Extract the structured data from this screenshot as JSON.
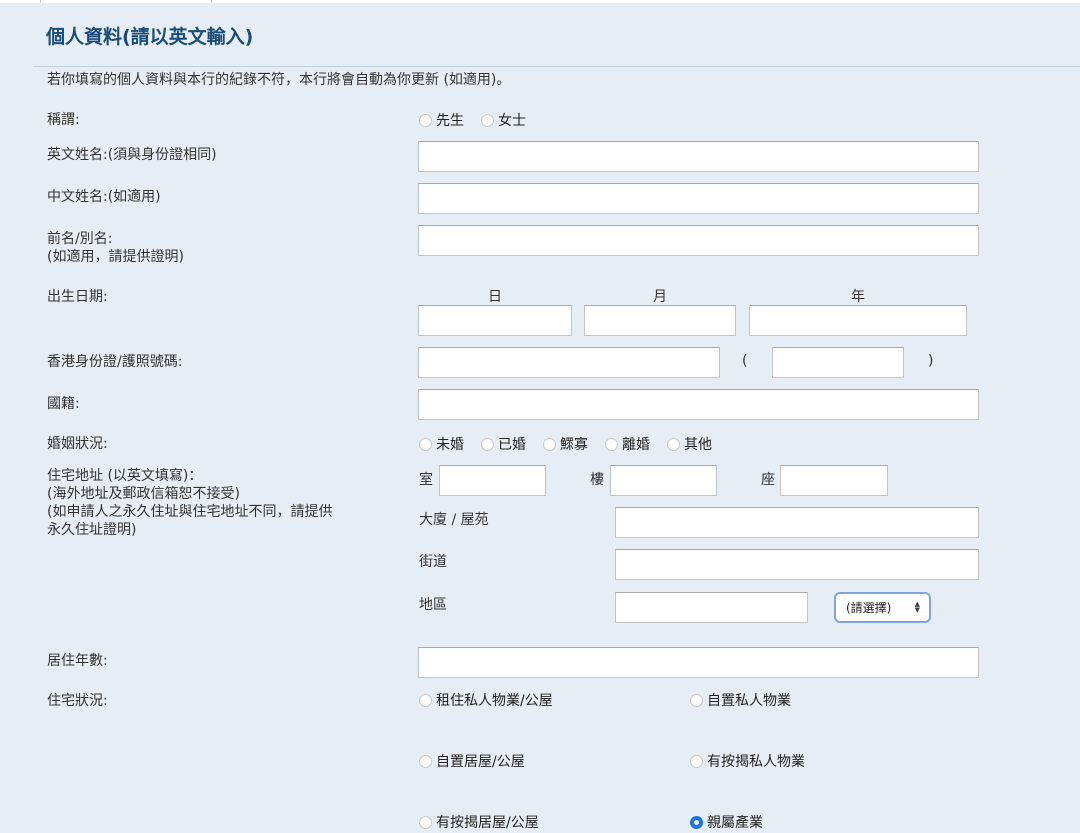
{
  "section": {
    "title": "個人資料(請以英文輸入)",
    "notice": "若你填寫的個人資料與本行的紀錄不符，本行將會自動為你更新 (如適用)。"
  },
  "fields": {
    "title_label": "稱謂:",
    "title_options": [
      "先生",
      "女士"
    ],
    "english_name_label": "英文姓名:(須與身份證相同)",
    "chinese_name_label": "中文姓名:(如適用)",
    "alias_label": "前名/別名:\n(如適用，請提供證明)",
    "dob_label": "出生日期:",
    "dob_day": "日",
    "dob_month": "月",
    "dob_year": "年",
    "id_label": "香港身份證/護照號碼:",
    "id_open": "(",
    "id_close": ")",
    "nationality_label": "國籍:",
    "marital_label": "婚姻狀況:",
    "marital_options": [
      "未婚",
      "已婚",
      "鰥寡",
      "離婚",
      "其他"
    ],
    "address_label": "住宅地址 (以英文填寫)：\n(海外地址及郵政信箱恕不接受)\n(如申請人之永久住址與住宅地址不同，請提供\n永久住址證明)",
    "room_label": "室",
    "floor_label": "樓",
    "block_label": "座",
    "building_label": "大廈 / 屋苑",
    "street_label": "街道",
    "district_label": "地區",
    "district_select": "(請選擇)",
    "years_label": "居住年數:",
    "housing_label": "住宅狀況:",
    "housing_options": [
      "租住私人物業/公屋",
      "自置私人物業",
      "自置居屋/公屋",
      "有按揭私人物業",
      "有按揭居屋/公屋",
      "親屬產業"
    ],
    "housing_selected": "親屬產業"
  }
}
